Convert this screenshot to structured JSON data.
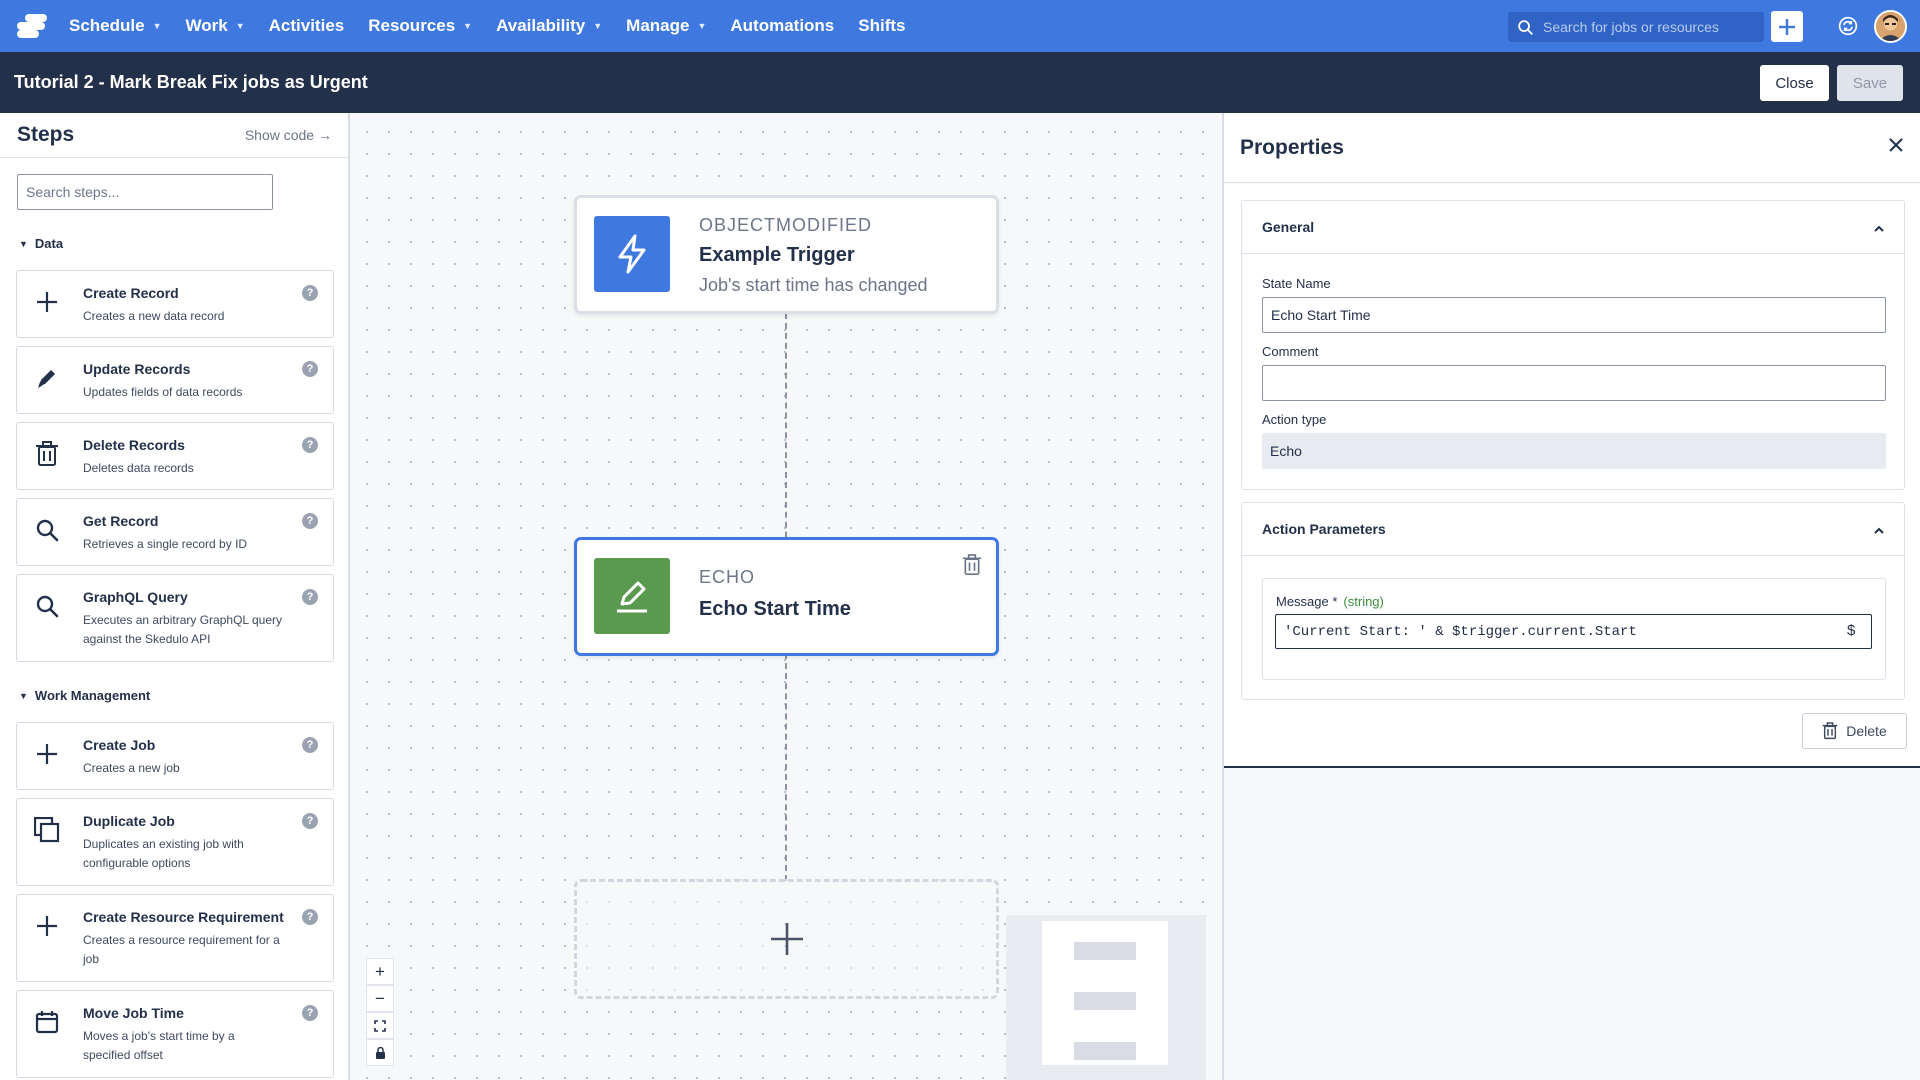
{
  "nav": {
    "items": [
      {
        "label": "Schedule",
        "dropdown": true
      },
      {
        "label": "Work",
        "dropdown": true
      },
      {
        "label": "Activities",
        "dropdown": false
      },
      {
        "label": "Resources",
        "dropdown": true
      },
      {
        "label": "Availability",
        "dropdown": true
      },
      {
        "label": "Manage",
        "dropdown": true
      },
      {
        "label": "Automations",
        "dropdown": false
      },
      {
        "label": "Shifts",
        "dropdown": false
      }
    ],
    "search_placeholder": "Search for jobs or resources",
    "colors": {
      "bar": "#3f79e0",
      "search": "#2f63c4"
    }
  },
  "titlebar": {
    "title": "Tutorial 2 - Mark Break Fix jobs as Urgent",
    "close_label": "Close",
    "save_label": "Save"
  },
  "steps": {
    "title": "Steps",
    "show_code": "Show code →",
    "search_placeholder": "Search steps...",
    "sections": [
      {
        "label": "Data",
        "items": [
          {
            "name": "Create Record",
            "desc": "Creates a new data record",
            "icon": "plus-icon"
          },
          {
            "name": "Update Records",
            "desc": "Updates fields of data records",
            "icon": "pencil-icon"
          },
          {
            "name": "Delete Records",
            "desc": "Deletes data records",
            "icon": "trash-icon"
          },
          {
            "name": "Get Record",
            "desc": "Retrieves a single record by ID",
            "icon": "search-icon"
          },
          {
            "name": "GraphQL Query",
            "desc": "Executes an arbitrary GraphQL query against the Skedulo API",
            "icon": "search-icon"
          }
        ]
      },
      {
        "label": "Work Management",
        "items": [
          {
            "name": "Create Job",
            "desc": "Creates a new job",
            "icon": "plus-icon"
          },
          {
            "name": "Duplicate Job",
            "desc": "Duplicates an existing job with configurable options",
            "icon": "duplicate-icon"
          },
          {
            "name": "Create Resource Requirement",
            "desc": "Creates a resource requirement for a job",
            "icon": "plus-icon"
          },
          {
            "name": "Move Job Time",
            "desc": "Moves a job's start time by a specified offset",
            "icon": "calendar-icon"
          }
        ]
      }
    ],
    "help_glyph": "?"
  },
  "canvas": {
    "trigger": {
      "type": "OBJECTMODIFIED",
      "title": "Example Trigger",
      "subtitle": "Job's start time has changed",
      "color": "#3f79e0"
    },
    "echo": {
      "type": "ECHO",
      "title": "Echo Start Time",
      "color": "#5a9a4e"
    }
  },
  "properties": {
    "title": "Properties",
    "general": {
      "heading": "General",
      "state_name_label": "State Name",
      "state_name_value": "Echo Start Time",
      "comment_label": "Comment",
      "comment_value": "",
      "action_type_label": "Action type",
      "action_type_value": "Echo"
    },
    "params": {
      "heading": "Action Parameters",
      "message_label": "Message *",
      "message_type": "(string)",
      "message_value": "'Current Start: ' & $trigger.current.Start",
      "expr_glyph": "$"
    },
    "delete_label": "Delete"
  }
}
